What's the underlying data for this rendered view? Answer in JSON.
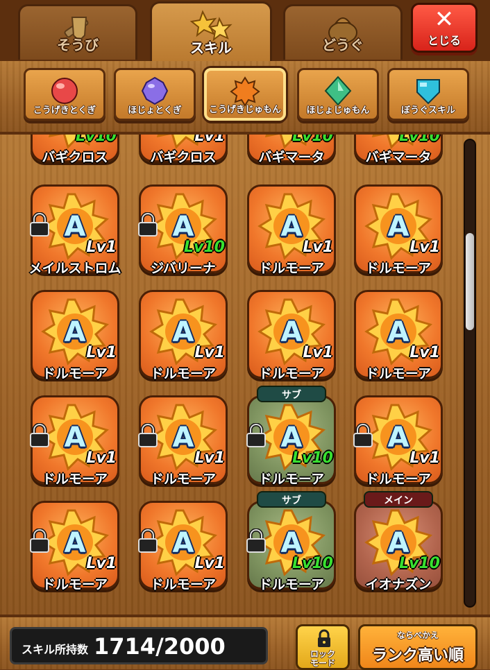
{
  "tabs": [
    {
      "label": "そうび",
      "icon": "sword-shield-icon",
      "active": false
    },
    {
      "label": "スキル",
      "icon": "skill-stars-icon",
      "active": true
    },
    {
      "label": "どうぐ",
      "icon": "item-bag-icon",
      "active": false
    }
  ],
  "close_button": {
    "label": "とじる",
    "icon": "close-x-icon"
  },
  "categories": [
    {
      "label": "こうげきとくぎ",
      "icon": "red-orb-icon",
      "color": "#e84848"
    },
    {
      "label": "ほじょとくぎ",
      "icon": "purple-gem-icon",
      "color": "#8a6ee6"
    },
    {
      "label": "こうげきじゅもん",
      "icon": "orange-star-icon",
      "color": "#f07d1e",
      "active": true
    },
    {
      "label": "ほじょじゅもん",
      "icon": "green-diamond-icon",
      "color": "#3fbf85"
    },
    {
      "label": "ぼうぐスキル",
      "icon": "cyan-shield-icon",
      "color": "#2fc0dc"
    }
  ],
  "partial_row": [
    {
      "name": "バギクロス",
      "level": "Lv10",
      "max": true
    },
    {
      "name": "バギクロス",
      "level": "Lv1",
      "max": false
    },
    {
      "name": "バギマータ",
      "level": "Lv10",
      "max": true
    },
    {
      "name": "バギマータ",
      "level": "Lv10",
      "max": true
    }
  ],
  "skills": [
    {
      "rank": "A",
      "name": "メイルストロム",
      "level": "Lv1",
      "max": false,
      "locked": true,
      "tag": ""
    },
    {
      "rank": "A",
      "name": "ジバリーナ",
      "level": "Lv10",
      "max": true,
      "locked": true,
      "tag": ""
    },
    {
      "rank": "A",
      "name": "ドルモーア",
      "level": "Lv1",
      "max": false,
      "locked": false,
      "tag": ""
    },
    {
      "rank": "A",
      "name": "ドルモーア",
      "level": "Lv1",
      "max": false,
      "locked": false,
      "tag": ""
    },
    {
      "rank": "A",
      "name": "ドルモーア",
      "level": "Lv1",
      "max": false,
      "locked": false,
      "tag": ""
    },
    {
      "rank": "A",
      "name": "ドルモーア",
      "level": "Lv1",
      "max": false,
      "locked": false,
      "tag": ""
    },
    {
      "rank": "A",
      "name": "ドルモーア",
      "level": "Lv1",
      "max": false,
      "locked": false,
      "tag": ""
    },
    {
      "rank": "A",
      "name": "ドルモーア",
      "level": "Lv1",
      "max": false,
      "locked": false,
      "tag": ""
    },
    {
      "rank": "A",
      "name": "ドルモーア",
      "level": "Lv1",
      "max": false,
      "locked": true,
      "tag": ""
    },
    {
      "rank": "A",
      "name": "ドルモーア",
      "level": "Lv1",
      "max": false,
      "locked": true,
      "tag": ""
    },
    {
      "rank": "A",
      "name": "ドルモーア",
      "level": "Lv10",
      "max": true,
      "locked": true,
      "tag": "サブ"
    },
    {
      "rank": "A",
      "name": "ドルモーア",
      "level": "Lv1",
      "max": false,
      "locked": true,
      "tag": ""
    },
    {
      "rank": "A",
      "name": "ドルモーア",
      "level": "Lv1",
      "max": false,
      "locked": true,
      "tag": ""
    },
    {
      "rank": "A",
      "name": "ドルモーア",
      "level": "Lv1",
      "max": false,
      "locked": true,
      "tag": ""
    },
    {
      "rank": "A",
      "name": "ドルモーア",
      "level": "Lv10",
      "max": true,
      "locked": true,
      "tag": "サブ"
    },
    {
      "rank": "A",
      "name": "イオナズン",
      "level": "Lv10",
      "max": true,
      "locked": false,
      "tag": "メイン"
    }
  ],
  "bottom": {
    "count_label": "スキル所持数",
    "count_value": "1714/2000",
    "lock_mode_label": "ロック\nモード",
    "sort_caption": "ならべかえ",
    "sort_value": "ランク高い順"
  },
  "scrollbar": {
    "position": 0.2
  }
}
